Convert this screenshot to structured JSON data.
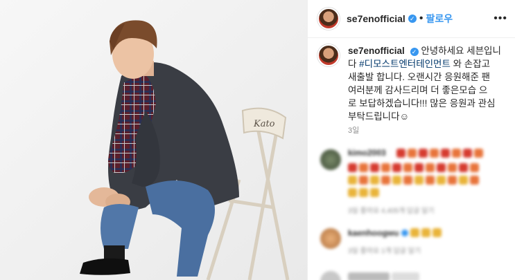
{
  "post": {
    "username": "se7enofficial",
    "verified_mark": "✓",
    "separator": "•",
    "follow_label": "팔로우",
    "more_icon": "•••",
    "caption_username": "se7enofficial",
    "caption_line1": "안녕하세요 세븐입니",
    "caption_line2_prefix": "다 ",
    "hashtag": "#디모스트엔터테인먼트",
    "caption_line2_suffix": " 와 손잡고",
    "caption_line3": "새출발 합니다. 오랜시간 응원해준 팬",
    "caption_line4": "여러분께 감사드리며 더 좋은모습 으",
    "caption_line5": "로 보답하겠습니다!!! 많은 응원과 관심",
    "caption_line6": "부탁드립니다☺",
    "time_ago": "3일"
  },
  "photo": {
    "chair_text": "Kato"
  },
  "comments": [
    {
      "username": "kimo2003",
      "line2": "",
      "meta": "3일   좋아요 4,405개   답글 달기"
    },
    {
      "username": "kaenhoogwu",
      "meta": "3일   좋아요 1개   답글 달기"
    }
  ],
  "colors": {
    "accent": "#3897f0",
    "hashtag": "#00376b",
    "muted": "#8e8e8e"
  }
}
